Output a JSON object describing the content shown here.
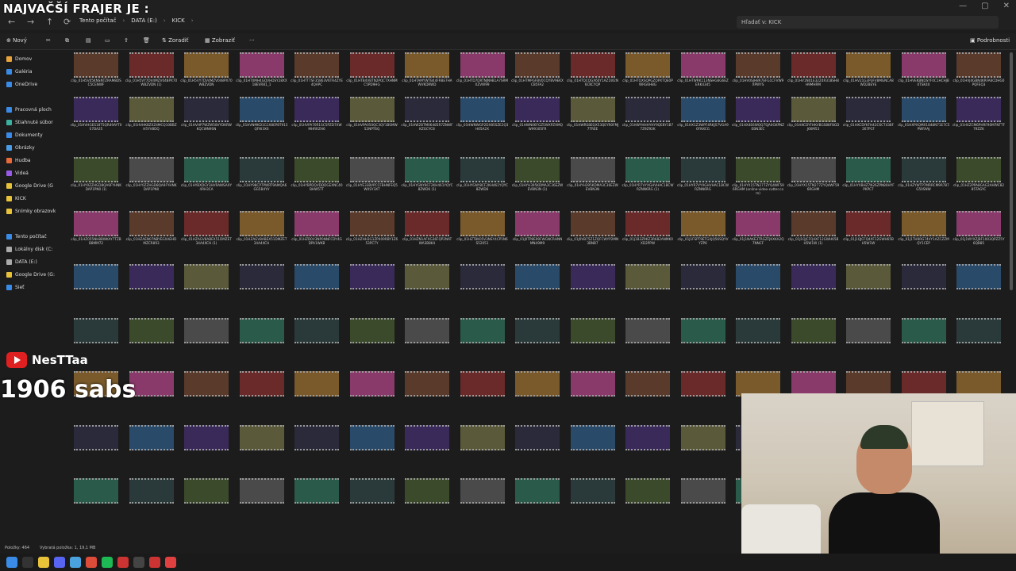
{
  "overlay": {
    "title": "NAJVAČŠÍ FRAJER JE :",
    "yt_channel": "NesTTaa",
    "subs": "1906 sabs"
  },
  "addressbar": {
    "crumbs": [
      "Tento počítač",
      "DATA (E:)",
      "KICK"
    ],
    "search_placeholder": "Hľadať v: KICK"
  },
  "toolbar": {
    "new_label": "Nový",
    "sort_label": "Zoradiť",
    "view_label": "Zobraziť",
    "more_label": "···",
    "details_label": "Podrobnosti"
  },
  "sidebar": {
    "items": [
      {
        "label": "Domov",
        "icon": "home-icon",
        "color": "#e8a33a"
      },
      {
        "label": "Galéria",
        "icon": "gallery-icon",
        "color": "#3a8be8"
      },
      {
        "label": "OneDrive",
        "icon": "cloud-icon",
        "color": "#3a8be8"
      },
      {
        "label": "Pracovná ploch",
        "icon": "desktop-icon",
        "color": "#3a8be8"
      },
      {
        "label": "Stiahnuté súbor",
        "icon": "download-icon",
        "color": "#3ab0a0"
      },
      {
        "label": "Dokumenty",
        "icon": "documents-icon",
        "color": "#3a8be8"
      },
      {
        "label": "Obrázky",
        "icon": "pictures-icon",
        "color": "#4a9be8"
      },
      {
        "label": "Hudba",
        "icon": "music-icon",
        "color": "#e86a3a"
      },
      {
        "label": "Videá",
        "icon": "video-icon",
        "color": "#9a5ae8"
      },
      {
        "label": "Google Drive (G",
        "icon": "drive-icon",
        "color": "#e8c33a"
      },
      {
        "label": "KICK",
        "icon": "folder-icon",
        "color": "#e8c33a"
      },
      {
        "label": "Snímky obrazovk",
        "icon": "folder-icon",
        "color": "#e8c33a"
      },
      {
        "label": "Tento počítač",
        "icon": "computer-icon",
        "color": "#3a8be8"
      },
      {
        "label": "Lokálny disk (C:",
        "icon": "disk-icon",
        "color": "#aaaaaa"
      },
      {
        "label": "DATA (E:)",
        "icon": "disk-icon",
        "color": "#aaaaaa"
      },
      {
        "label": "Google Drive (G:",
        "icon": "drive-icon",
        "color": "#e8c33a"
      },
      {
        "label": "Sieť",
        "icon": "network-icon",
        "color": "#3a8be8"
      }
    ]
  },
  "status": {
    "items_count": "Položky: 464",
    "selected": "Vybratá položka: 1, 19,1 MB"
  },
  "files": {
    "rows": [
      [
        "clip_01H5V05KNSNTZRAM8DSC5CENWF",
        "clip_01H5VY7DV4MZV048PX70W8ZVDN (1)",
        "clip_01H5VY7DV4MZV048PX70W8ZVDN",
        "clip_01HT0MH4GQVHDSY28XX18EVR81_1",
        "clip_01HTT7SF35863V6TR4ZYE4QAPC",
        "clip_01HTB4VBTN2PQC7XHNMC5PD9HG",
        "clip_01HTAMYWTB44FR8E7HAWVKDRWD",
        "clip_01HTD7DRTNJN9B1A7SRMXZVW99",
        "clip_01HTMPGFBV0CQYBV9EKXCB5FA2",
        "clip_01HTQCQGX60Y1AZ1W2N6CKCYQP",
        "clip_01HTQXSQPGZQPXTQE0PWRG6H8G",
        "clip_01HTWRK113NSHG6G6EZERK4345",
        "clip_01HV0SJH8R7EFG1CFVW9XPWYS",
        "clip_01HV1N01E32Z4R318SH8H9MHRM",
        "clip_01HV21G3P3FV8MGNCA8WD2BEYE",
        "clip_01HVEKBNDSYF0C1HCHJB0TSK40",
        "clip_01HVJ4GBN4KRFA6CDHG0PQFEQ3"
      ],
      [
        "clip_01HVHGES18T5QR49AYT0S7DA25",
        "clip_01HVHK8ZXZ4MCQ10BBZH5YV8DQ",
        "clip_01HVHP7WZW58VYDKRWKQCWN9SN",
        "clip_01HVNMKD1G1X8EP8T913QFW3X0",
        "clip_01HVPA70R1SC5PZD7XWMHRRZH6",
        "clip_01HVPA050QC3QY1BSMW52NPT6Q",
        "clip_01HW2BTM06485R7ZNWFKZGCYC8",
        "clip_01HWNWGP2DX85SZE2Q3H65A2X",
        "clip_01HWN66FGZ5WXPZXMQW99305FR",
        "clip_01HWRS8EQX53QEYR0FMJ7TREE",
        "clip_01HWYHHHYHY9QE8Y1B77Z9Z92K",
        "clip_01HX1Z3WPF4RKJS7VGA90FNXCG",
        "clip_01HX4E6WQQ7SJA0GKPNZEBN3EC",
        "clip_01HXCDYFHKVBGS88FBGDJ66M53",
        "clip_01HXCDYKFH42C6CT438F267PCF",
        "clip_01HXPXQMX1848N71E7C5PWFAAJ",
        "clip_01HXZCM6PHRF90M7NTTF79ZZK"
      ],
      [
        "clip_01HY0ZZHGD8QA9FYHNKDAP1PN0 (1)",
        "clip_01HY0ZZHGD8QA9FYHNKDAP1PN0",
        "clip_01HYBXDGY3HVRAWSAXY4RH3CA",
        "clip_01HY98CP7PWRT9AMQA6GG5B4YV",
        "clip_01HYBPDQVDDDGEXNC40BHW5TT",
        "clip_01HYE33BVPCCFBHNFEQ5WXSY3XT",
        "clip_01HYGNY8CF2KH461YQYC8ZWD6 (1)",
        "clip_01HYGNY8CF2KH461YQYC8ZWD6",
        "clip_01HYH395KDMA3C36EZWEVBN3N (1)",
        "clip_01HYH395KDMA3C36EZWEVBN3N",
        "clip_01HYR7VYXGHVHAC1BCWRZNN6RG (1)",
        "clip_01HYR7VYXGHVHAC1BCWRZNN6RG",
        "clip_01HYX15TN277ZYQ4WF596RGHM (online-video-cutter.com)",
        "clip_01HYX15TN277ZYQ4WF596RGHM",
        "clip_01HYXBHZ7N26ZPN80HYFPKPC7",
        "clip_01HZYWTP7MRRCM9R787G50SNW",
        "clip_01HZ2PPA8GAG2AHWC8285TAGYC"
      ],
      [
        "clip_01HZ055NH8BWKAY7TZBB8MM72",
        "clip_01HZAEN07NBYEGXAEHDMZCR893",
        "clip_01HZAGV8ABEX51DMZET34A4XCH (1)",
        "clip_01HZAGV8ABEX51DMZET34A4XCH",
        "clip_01HZD0V3NP0NNFCDY4GDPA1WKB",
        "clip_01HZHH3G1ZP409RBY1Z653PC7Y",
        "clip_01HZN1AFXG36FQP2NATWA3B8K4",
        "clip_01HZT8K05V3NSY4CP1N6S52051",
        "clip_01J0TP8E99FWGNCRHNNMN49M9",
        "clip_01J0VB75Z1ZQFCWYP2MN3BNB7",
        "clip_01J1B3Z9KZ3R682ANMK0XD2PPW",
        "clip_01J1FSPT9ETGXJQ56SQYVYZP6",
        "clip_01J1NAKE3TRGZFJKXKA2Q7NNCF",
        "clip_01J1QJCFQ4XF12GWH65BH5W1W (1)",
        "clip_01J1QJCFQ4XF12GWH65BH5W1W",
        "clip_01J1TH9RG74VY1AZCZZMQY1CEP",
        "clip_01J1WYXZJBF1003QPZZ5Y6QB85"
      ]
    ]
  }
}
